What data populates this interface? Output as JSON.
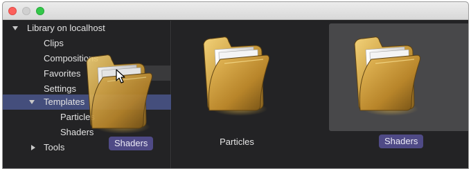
{
  "window": {
    "traffic_lights": [
      "close",
      "minimize",
      "zoom"
    ]
  },
  "sidebar": {
    "items": [
      {
        "label": "Library on localhost",
        "expanded": true
      },
      {
        "label": "Clips"
      },
      {
        "label": "Compositions"
      },
      {
        "label": "Favorites"
      },
      {
        "label": "Settings"
      },
      {
        "label": "Templates",
        "expanded": true,
        "selected": true
      },
      {
        "label": "Particles"
      },
      {
        "label": "Shaders"
      },
      {
        "label": "Tools",
        "expanded": false
      }
    ]
  },
  "drag": {
    "ghost_label": "Shaders",
    "cursor_icon": "arrow-cursor-icon"
  },
  "content": {
    "folders": [
      {
        "label": "Particles",
        "selected": false
      },
      {
        "label": "Shaders",
        "selected": true
      }
    ]
  },
  "colors": {
    "selection": "#444e7c",
    "pill": "#4f4a86",
    "background": "#232325",
    "selected_tile": "#48484a"
  }
}
